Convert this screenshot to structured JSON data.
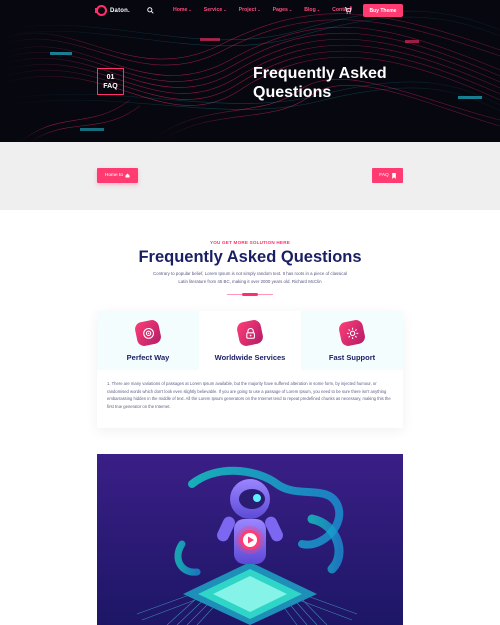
{
  "nav": {
    "logo_text": "Daton.",
    "items": [
      {
        "label": "Home",
        "chevron": "⌄"
      },
      {
        "label": "Service",
        "chevron": "⌄"
      },
      {
        "label": "Project",
        "chevron": "⌄"
      },
      {
        "label": "Pages",
        "chevron": "⌄"
      },
      {
        "label": "Blog",
        "chevron": "⌄"
      },
      {
        "label": "Contact",
        "chevron": ""
      }
    ],
    "buy_label": "Buy Theme",
    "icons": [
      "search-icon",
      "cart-icon"
    ]
  },
  "hero": {
    "badge_number": "01",
    "badge_label": "FAQ",
    "title": "Frequently Asked Questions"
  },
  "breadcrumb": {
    "home_label": "Home to",
    "current_label": "FAQ"
  },
  "section": {
    "eyebrow": "YOU GET MORE SOLUTION HERE",
    "title": "Frequently Asked Questions",
    "description": "Contrary to popular belief, Lorem Ipsum is not simply random text. It has roots in a piece of classical Latin literature from 45 BC, making it over 2000 years old. Richard McClin"
  },
  "features": {
    "items": [
      {
        "label": "Perfect Way",
        "icon": "target-icon"
      },
      {
        "label": "Worldwide Services",
        "icon": "lock-icon"
      },
      {
        "label": "Fast Support",
        "icon": "gear-icon"
      }
    ],
    "text": "1. There are many variations of passages at Lorem Ipsum available, but the majority have suffered alteration in some form, by injected humour, or randomised words which don't look even slightly believable. If you are going to use a passage of Lorem Ipsum, you need to be sure there isn't anything embarrassing hidden in the middle of text. All the Lorem Ipsum generators on the Internet tend to repeat predefined chunks as necessary, making this the first true generator on the Internet."
  },
  "colors": {
    "accent": "#ff3b72",
    "navy": "#1a1f63",
    "hero_bg": "#06070f",
    "illustration_bg": "#2b1f7a"
  }
}
